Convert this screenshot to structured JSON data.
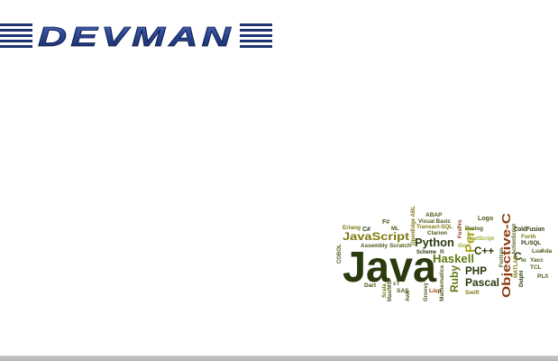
{
  "logo": {
    "text": "DEVMAN",
    "color_dark": "#1f3470",
    "color_light": "#3f5fb0"
  },
  "word_cloud": {
    "words": [
      "Java",
      "JavaScript",
      "Python",
      "Haskell",
      "Ruby",
      "PHP",
      "Pascal",
      "Perl",
      "Objective-C",
      "C++",
      "C",
      "C#",
      "F#",
      "ML",
      "Erlang",
      "ABAP",
      "Visual Basic",
      "Logo",
      "Prolog",
      "Clarion",
      "Transact-SQL",
      "FoxPro",
      "OpenEdge ABL",
      "PostScript",
      "ColdFusion",
      "Forth",
      "PL/SQL",
      "Lua",
      "Ada",
      "Io",
      "Yacc",
      "TCL",
      "MATLAB",
      "Delphi",
      "PL/I",
      "Fortran",
      "Assembly",
      "Scratch",
      "Scheme",
      "R",
      "Go",
      "COBOL",
      "Dart",
      "Scala",
      "cT",
      "SAS",
      "Max/MSP",
      "Groovy",
      "Lisp",
      "Swift",
      "Mathematica",
      "Awk",
      "ActionScript"
    ]
  },
  "colors": {
    "bottom_bar": "#bdbdbd"
  }
}
